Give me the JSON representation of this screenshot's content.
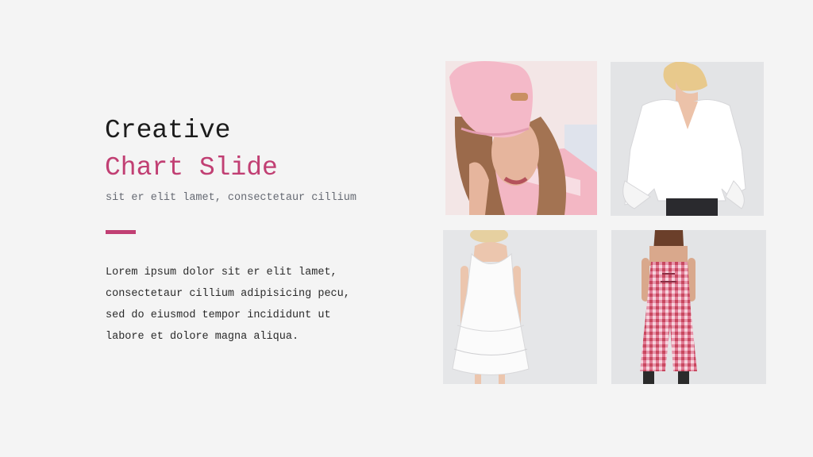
{
  "slide": {
    "title_line1": "Creative",
    "title_line2": "Chart Slide",
    "subtitle": "sit er elit lamet, consectetaur cillium",
    "body_lines": [
      "Lorem ipsum dolor sit er elit lamet,",
      "consectetaur cillium adipisicing pecu,",
      "sed do eiusmod tempor incididunt ut",
      "labore et dolore magna aliqua."
    ]
  },
  "colors": {
    "background": "#f4f4f4",
    "accent": "#c13f73",
    "title": "#1c1c1c",
    "subtitle": "#666a73",
    "body": "#2a2a2a"
  },
  "photos": [
    {
      "subject": "woman-pink-cap-photo"
    },
    {
      "subject": "white-blouse-photo"
    },
    {
      "subject": "white-lace-dress-photo"
    },
    {
      "subject": "gingham-jumpsuit-photo"
    }
  ]
}
